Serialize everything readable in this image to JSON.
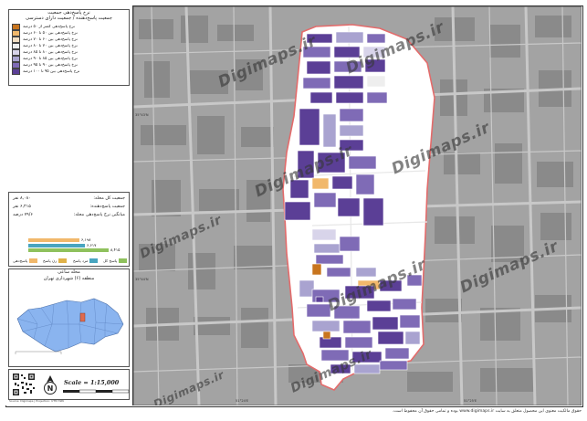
{
  "legend": {
    "title_line1": "نرخ پاسخ‌دهی جمعیت",
    "title_line2": "جمعیت پاسخ‌دهنده / جمعیت دارای دسترسی",
    "items": [
      {
        "label": "نرخ پاسخ‌دهی کمتر از ۵۰ درصد",
        "color": "#c8751e"
      },
      {
        "label": "نرخ پاسخ‌دهی بین ۵۰ تا ۶۰ درصد",
        "color": "#f1b86b"
      },
      {
        "label": "نرخ پاسخ‌دهی بین ۶۰ تا ۷۰ درصد",
        "color": "#f3dfc4"
      },
      {
        "label": "نرخ پاسخ‌دهی بین ۷۰ تا ۸۰ درصد",
        "color": "#eeeeee"
      },
      {
        "label": "نرخ پاسخ‌دهی بین ۸۰ تا ۸۵ درصد",
        "color": "#d8d4ea"
      },
      {
        "label": "نرخ پاسخ‌دهی بین ۸۵ تا ۹۰ درصد",
        "color": "#a9a3d0"
      },
      {
        "label": "نرخ پاسخ‌دهی بین ۹۰ تا ۹۵ درصد",
        "color": "#7f6bb6"
      },
      {
        "label": "نرخ پاسخ‌دهی بین ۹۵ تا ۱۰۰ درصد",
        "color": "#5b3f96"
      }
    ]
  },
  "stats": {
    "rows": [
      {
        "label": "جمعیت کل محله:",
        "value": "۸,۰۸۰ نفر"
      },
      {
        "label": "جمعیت پاسخ‌دهنده:",
        "value": "۶,۴۱۵ نفر"
      },
      {
        "label": "میانگین نرخ پاسخ‌دهی محله:",
        "value": "۷۹/۶ درصد"
      }
    ],
    "bars": [
      {
        "label": "۶,۱۹۸",
        "fraction": 0.56,
        "color": "#f1b86b"
      },
      {
        "label": "۶,۶۱۷",
        "fraction": 0.62,
        "color": "#48a5c0"
      },
      {
        "label": "۸,۴۱۵",
        "fraction": 0.88,
        "color": "#8fc15d"
      }
    ],
    "keys": [
      {
        "label": "پاسخ‌دهی",
        "color": "#f1b86b"
      },
      {
        "label": "زن پاسخ",
        "color": "#e0b24a"
      },
      {
        "label": "مرد پاسخ",
        "color": "#48a5c0"
      },
      {
        "label": "پاسخ کل",
        "color": "#8fc15d"
      }
    ]
  },
  "location": {
    "title_line1": "محله ساعی",
    "title_line2": "منطقه (۶) شهرداری تهران"
  },
  "scale_text": "Scale = 1:15,000",
  "map": {
    "grid_labels": [
      "51°24'E",
      "51°25'E",
      "35°43'N",
      "35°44'N"
    ],
    "watermark": "Digimaps.ir"
  },
  "footer_text": "حقوق مالکیت معنوی این محصول متعلق به سایت www.digimaps.ir بوده و تمامی حقوق آن محفوظ است.",
  "credit_text": "Source: Digimaps | Projection: UTM 39N"
}
